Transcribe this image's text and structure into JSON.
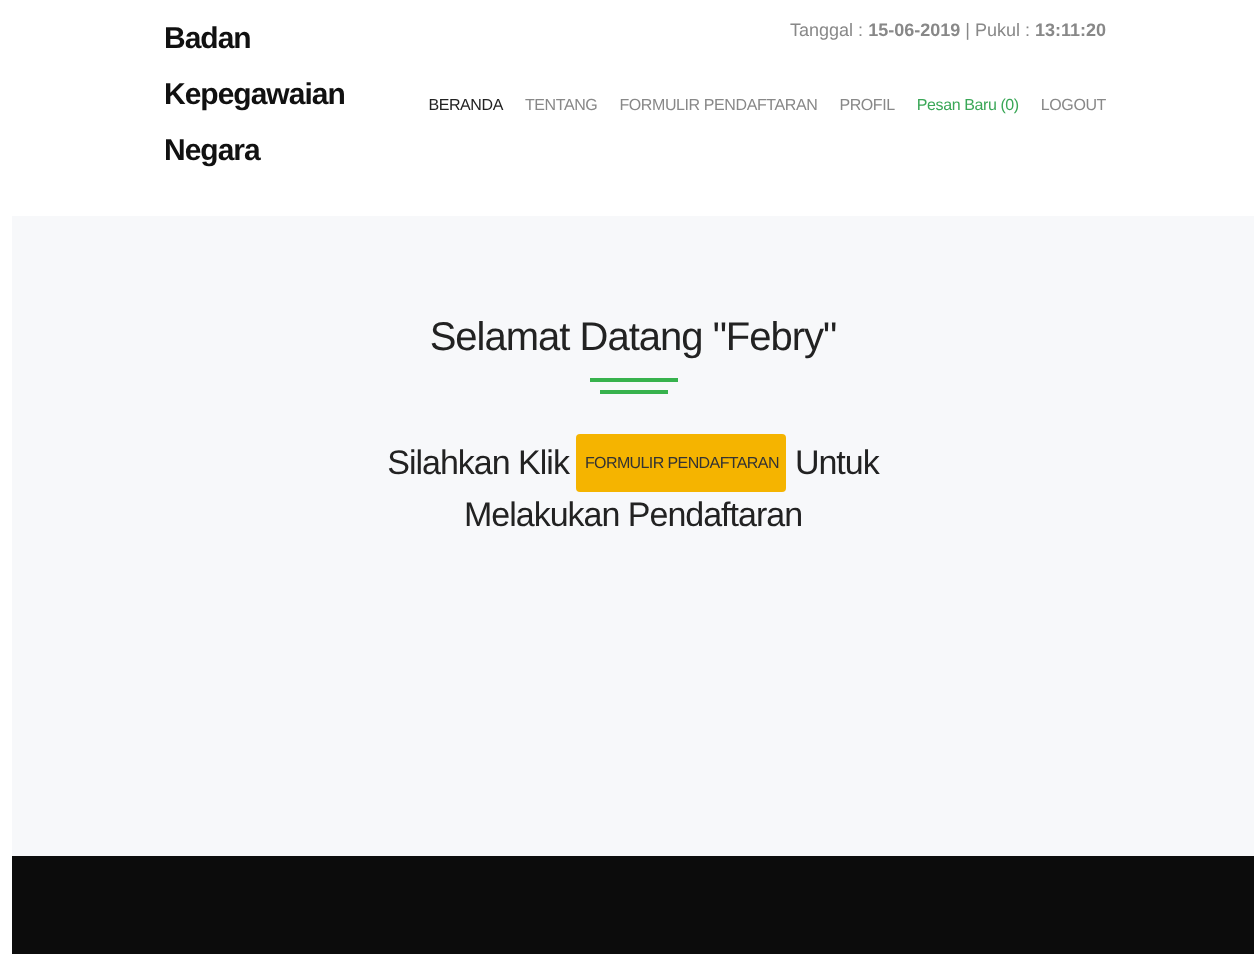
{
  "brand": [
    "Badan",
    "Kepegawaian",
    "Negara"
  ],
  "datetime": "Tanggal : **15-06-2019** | Pukul : **13:11:20**",
  "nav": [
    {
      "label": "BERANDA",
      "selected": true,
      "kind": "link"
    },
    {
      "label": "TENTANG",
      "selected": false,
      "kind": "link"
    },
    {
      "label": "FORMULIR PENDAFTARAN",
      "selected": false,
      "kind": "link"
    },
    {
      "label": "PROFIL",
      "selected": false,
      "kind": "link"
    },
    {
      "label": "Pesan Baru (0)",
      "selected": false,
      "kind": "message"
    },
    {
      "label": "LOGOUT",
      "selected": false,
      "kind": "link"
    }
  ],
  "welcome": {
    "title": "Selamat Datang \"Febry\"",
    "before": "Silahkan Klik",
    "button": "FORMULIR PENDAFTARAN",
    "after": "Untuk",
    "line2": "Melakukan Pendaftaran"
  }
}
